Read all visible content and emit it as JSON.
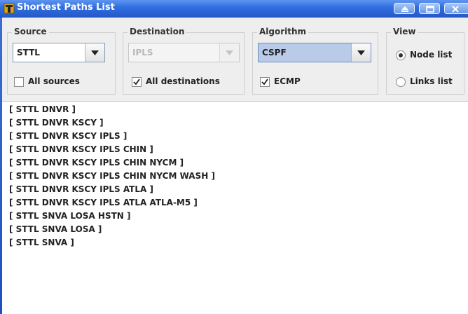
{
  "window": {
    "title": "Shortest Paths List"
  },
  "source": {
    "legend": "Source",
    "selected": "STTL",
    "all_checkbox": {
      "label": "All sources",
      "checked": false
    }
  },
  "destination": {
    "legend": "Destination",
    "selected": "IPLS",
    "disabled": true,
    "all_checkbox": {
      "label": "All destinations",
      "checked": true
    }
  },
  "algorithm": {
    "legend": "Algorithm",
    "selected": "CSPF",
    "ecmp_checkbox": {
      "label": "ECMP",
      "checked": true
    }
  },
  "view": {
    "legend": "View",
    "options": [
      {
        "label": "Node list",
        "selected": true
      },
      {
        "label": "Links list",
        "selected": false
      }
    ]
  },
  "paths": [
    "[ STTL DNVR ]",
    "[ STTL DNVR KSCY ]",
    "[ STTL DNVR KSCY IPLS ]",
    "[ STTL DNVR KSCY IPLS CHIN ]",
    "[ STTL DNVR KSCY IPLS CHIN NYCM ]",
    "[ STTL DNVR KSCY IPLS CHIN NYCM WASH ]",
    "[ STTL DNVR KSCY IPLS ATLA ]",
    "[ STTL DNVR KSCY IPLS ATLA ATLA-M5 ]",
    "[ STTL SNVA LOSA HSTN ]",
    "[ STTL SNVA LOSA ]",
    "[ STTL SNVA ]"
  ]
}
